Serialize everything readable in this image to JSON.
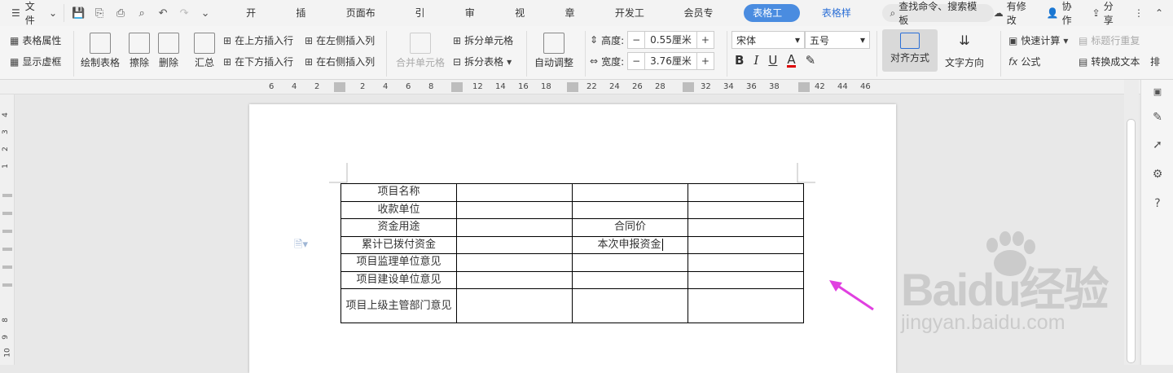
{
  "titlebar": {
    "menu_label": "文件",
    "tabs": [
      "开始",
      "插入",
      "页面布局",
      "引用",
      "审阅",
      "视图",
      "章节",
      "开发工具",
      "会员专享",
      "表格工具",
      "表格样式"
    ],
    "search_label": "查找命令、搜索模板",
    "right": {
      "modified": "有修改",
      "collab": "协作",
      "share": "分享"
    }
  },
  "ribbon": {
    "table_props": "表格属性",
    "show_grid": "显示虚框",
    "draw_table": "绘制表格",
    "erase": "擦除",
    "delete": "删除",
    "summary": "汇总",
    "insert_above": "在上方插入行",
    "insert_below": "在下方插入行",
    "insert_left": "在左侧插入列",
    "insert_right": "在右侧插入列",
    "merge_cells": "合并单元格",
    "split_cells": "拆分单元格",
    "split_table": "拆分表格",
    "auto_adjust": "自动调整",
    "height_label": "高度:",
    "height_value": "0.55厘米",
    "width_label": "宽度:",
    "width_value": "3.76厘米",
    "font_name": "宋体",
    "font_size": "五号",
    "align": "对齐方式",
    "text_dir": "文字方向",
    "quick_calc": "快速计算",
    "repeat_header": "标题行重复",
    "formula": "公式",
    "to_text": "转换成文本",
    "more": "排"
  },
  "hruler": [
    "6",
    "4",
    "2",
    "2",
    "4",
    "6",
    "8",
    "12",
    "14",
    "16",
    "18",
    "22",
    "24",
    "26",
    "28",
    "32",
    "34",
    "36",
    "38",
    "42",
    "44",
    "46"
  ],
  "vruler": [
    "4",
    "3",
    "2",
    "1",
    "8",
    "9",
    "10"
  ],
  "table": {
    "rows": [
      [
        "项目名称",
        "",
        "",
        ""
      ],
      [
        "收款单位",
        "",
        "",
        ""
      ],
      [
        "资金用途",
        "",
        "合同价",
        ""
      ],
      [
        "累计已拨付资金",
        "",
        "本次申报资金",
        ""
      ],
      [
        "项目监理单位意见",
        "",
        "",
        ""
      ],
      [
        "项目建设单位意见",
        "",
        "",
        ""
      ],
      [
        "项目上级主管部门意见",
        "",
        "",
        ""
      ]
    ]
  },
  "watermark": {
    "brand": "Baidu经验",
    "url": "jingyan.baidu.com"
  },
  "colors": {
    "accent": "#4a8ce0",
    "arrow": "#e040e0"
  }
}
